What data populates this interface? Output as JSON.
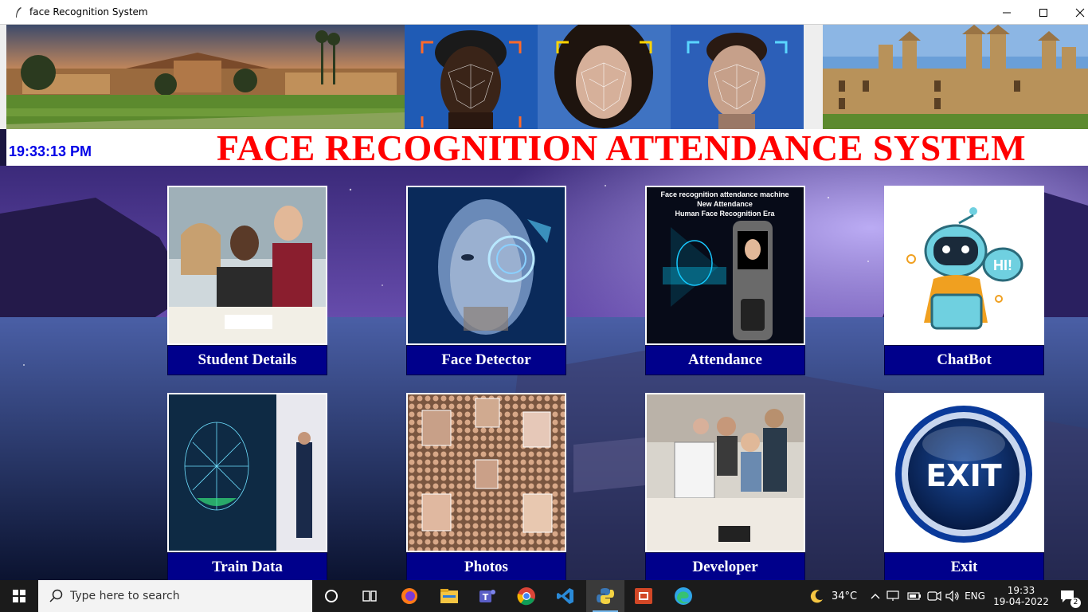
{
  "window": {
    "title": "face Recognition System",
    "controls": {
      "minimize": "minimize",
      "maximize": "maximize",
      "close": "close"
    }
  },
  "header": {
    "clock": "19:33:13 PM",
    "title": "FACE RECOGNITION ATTENDANCE SYSTEM"
  },
  "colors": {
    "title_red": "#ff0000",
    "clock_blue": "#0000e6",
    "label_bg": "#00008b",
    "taskbar": "#1b1b1b"
  },
  "attendance_image_text": {
    "line1": "Face recognition attendance machine",
    "line2": "New Attendance",
    "line3": "Human Face Recognition Era"
  },
  "chatbot_image_text": "HI!",
  "exit_image_text": "EXIT",
  "cards": [
    {
      "label": "Student Details"
    },
    {
      "label": "Face Detector"
    },
    {
      "label": "Attendance"
    },
    {
      "label": "ChatBot"
    },
    {
      "label": "Train Data"
    },
    {
      "label": "Photos"
    },
    {
      "label": "Developer"
    },
    {
      "label": "Exit"
    }
  ],
  "taskbar": {
    "search_placeholder": "Type here to search",
    "apps": [
      "task-view-icon",
      "firefox-icon",
      "file-explorer-icon",
      "teams-icon",
      "chrome-icon",
      "vscode-icon",
      "python-icon",
      "powerpoint-icon",
      "edge-icon"
    ],
    "weather": "34°C",
    "language": "ENG",
    "time": "19:33",
    "date": "19-04-2022",
    "notification_count": "2"
  }
}
